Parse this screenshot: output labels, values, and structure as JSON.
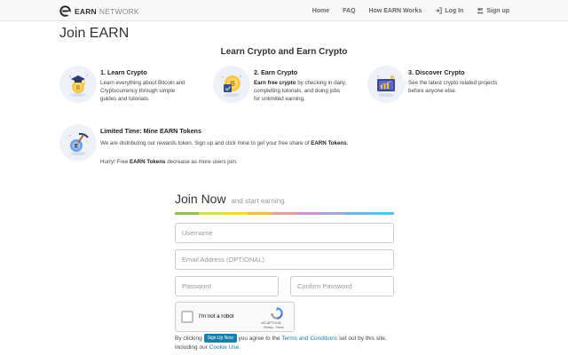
{
  "nav": {
    "brand_earn": "EARN",
    "brand_network": "NETWORK",
    "links": [
      {
        "label": "Home"
      },
      {
        "label": "FAQ"
      },
      {
        "label": "How EARN Works"
      },
      {
        "label": "Log In",
        "icon": "login-icon"
      },
      {
        "label": "Sign up",
        "icon": "users-icon"
      }
    ]
  },
  "page_title": "Join EARN",
  "section_heading": "Learn Crypto and Earn Crypto",
  "features": [
    {
      "icon": "graduate-coin-icon",
      "title": "1. Learn Crypto",
      "desc_line1": "Learn everything about Bitcoin and",
      "desc_line2": "Cryptocurrency through simple",
      "desc_line3": "guides and tutorials."
    },
    {
      "icon": "coin-checkbox-icon",
      "title": "2. Earn Crypto",
      "desc_bold": "Earn free crypto",
      "desc_line1_rest": " by checking in daily,",
      "desc_line2": "completing tutorials, and doing jobs",
      "desc_line3": "for unlimited earning."
    },
    {
      "icon": "chart-monitor-icon",
      "title": "3. Discover Crypto",
      "desc_line1": "See the latest crypto related projects",
      "desc_line2": "before anyone else."
    }
  ],
  "mine": {
    "icon": "pickaxe-coin-icon",
    "title": "Limited Time: Mine EARN Tokens",
    "line1_pre": "We are distributing our rewards token. Sign up and click mine to get your free share of ",
    "line1_bold": "EARN Tokens",
    "line1_post": ".",
    "line2_pre": "Hurry! Free ",
    "line2_bold": "EARN Tokens",
    "line2_post": " decrease as more users join."
  },
  "join": {
    "heading": "Join Now",
    "subheading": "and start earning.",
    "rainbow_colors": [
      "#8bc34a",
      "#d4e157",
      "#fdd835",
      "#ffb74d",
      "#ef9a9a",
      "#ce93d8",
      "#9fa8da",
      "#64b5f6",
      "#4fc3f7"
    ],
    "username_placeholder": "Username",
    "email_placeholder": "Email Address (OPTIONAL)",
    "password_placeholder": "Password",
    "confirm_placeholder": "Confirm Password"
  },
  "captcha": {
    "label": "I'm not a robot",
    "brand": "reCAPTCHA",
    "terms": "Privacy - Terms"
  },
  "terms": {
    "pre": "By clicking ",
    "button": "Sign Up Now",
    "mid": " you agree to the ",
    "link": "Terms and Conditions",
    "post": " set out by this site,",
    "line2_pre": "including our ",
    "line2_link": "Cookie Use",
    "line2_post": "."
  },
  "colors": {
    "accent": "#1a7fa8",
    "nav_bg": "#f8f8f8"
  }
}
